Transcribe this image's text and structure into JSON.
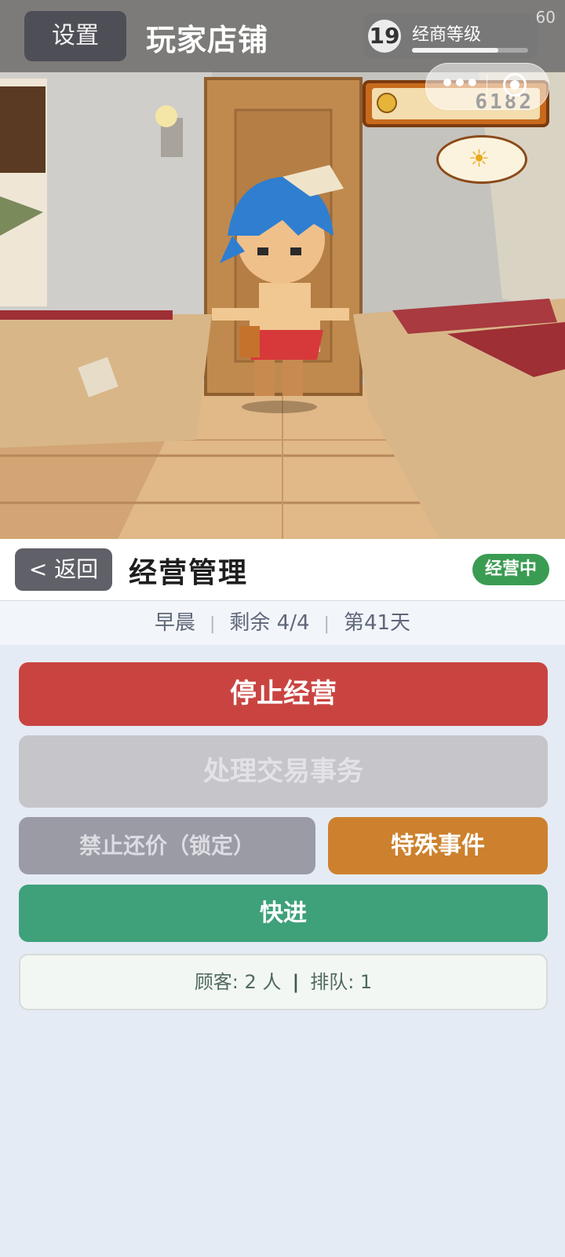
{
  "hud": {
    "settings_label": "设置",
    "shop_title": "玩家店铺",
    "level": {
      "number": "19",
      "label": "经商等级",
      "progress": 0.74
    },
    "fps": "60",
    "coins": "6182"
  },
  "management": {
    "back_label": "< 返回",
    "title": "经营管理",
    "status": "经营中",
    "info": {
      "time_of_day": "早晨",
      "remaining": "剩余 4/4",
      "day": "第41天"
    },
    "buttons": {
      "stop": "停止经营",
      "trade": "处理交易事务",
      "lock_bargain": "禁止还价（锁定）",
      "special_event": "特殊事件",
      "fast_forward": "快进"
    },
    "customers": {
      "customers": "顾客: 2 人",
      "queue": "排队: 1"
    }
  },
  "colors": {
    "stop": "#c94441",
    "trade_disabled": "#c6c5c9",
    "lock_disabled": "#9b9ba6",
    "event": "#cd812e",
    "fast_forward": "#3ea17a",
    "status_badge": "#3a9b52",
    "panel_bg": "#e5ebf4"
  }
}
